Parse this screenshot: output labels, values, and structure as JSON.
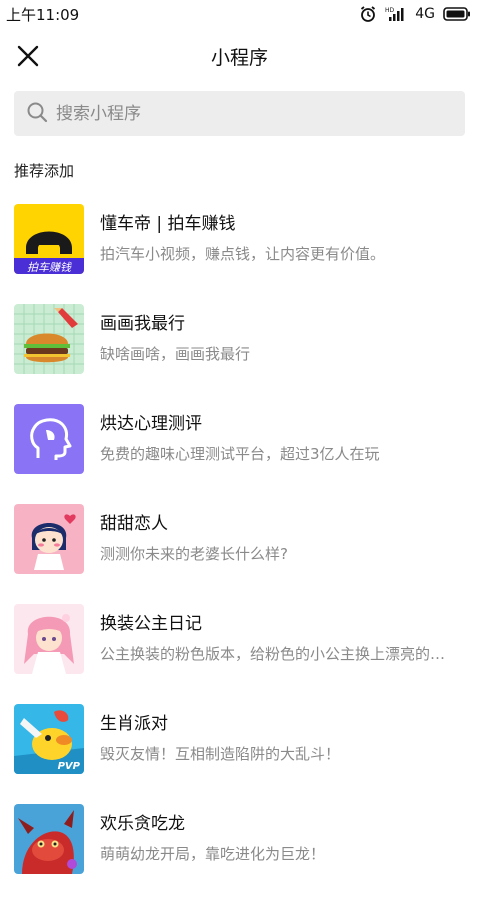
{
  "status_bar": {
    "time": "上午11:09",
    "network": "4G"
  },
  "header": {
    "title": "小程序"
  },
  "search": {
    "placeholder": "搜索小程序"
  },
  "section": {
    "title": "推荐添加"
  },
  "apps": [
    {
      "name": "懂车帝 | 拍车赚钱",
      "desc": "拍汽车小视频，赚点钱，让内容更有价值。",
      "icon": "dongchedi-icon",
      "icon_text": "拍车赚钱"
    },
    {
      "name": "画画我最行",
      "desc": "缺啥画啥，画画我最行",
      "icon": "burger-drawing-icon"
    },
    {
      "name": "烘达心理测评",
      "desc": "免费的趣味心理测试平台，超过3亿人在玩",
      "icon": "head-profile-icon"
    },
    {
      "name": "甜甜恋人",
      "desc": "测测你未来的老婆长什么样?",
      "icon": "cartoon-girl-icon"
    },
    {
      "name": "换装公主日记",
      "desc": "公主换装的粉色版本，给粉色的小公主换上漂亮的衣服",
      "icon": "princess-icon"
    },
    {
      "name": "生肖派对",
      "desc": "毁灭友情！互相制造陷阱的大乱斗！",
      "icon": "zodiac-party-icon",
      "icon_text": "PVP"
    },
    {
      "name": "欢乐贪吃龙",
      "desc": "萌萌幼龙开局，靠吃进化为巨龙！",
      "icon": "dragon-icon"
    }
  ]
}
